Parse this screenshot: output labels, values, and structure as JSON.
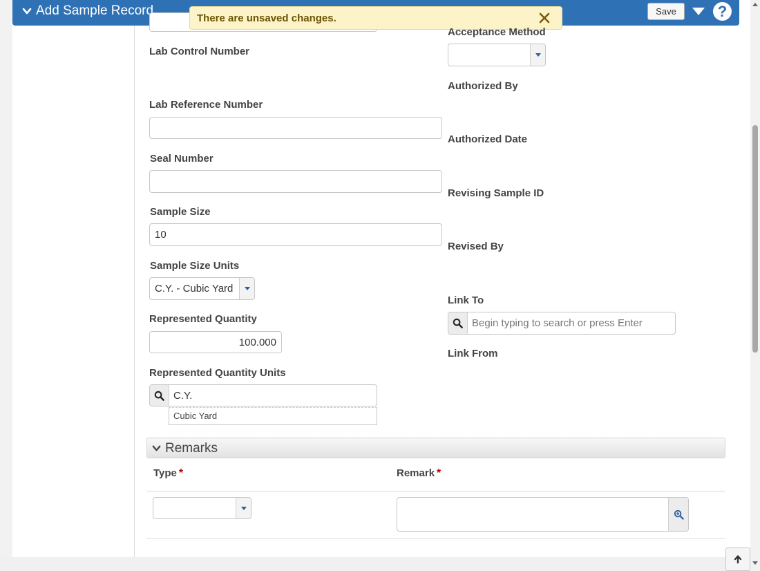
{
  "header": {
    "title": "Add Sample Record",
    "save_label": "Save",
    "help_label": "?"
  },
  "toast": {
    "message": "There are unsaved changes."
  },
  "left": {
    "lab_control_number": {
      "label": "Lab Control Number"
    },
    "lab_reference_number": {
      "label": "Lab Reference Number",
      "value": ""
    },
    "seal_number": {
      "label": "Seal Number",
      "value": ""
    },
    "sample_size": {
      "label": "Sample Size",
      "value": "10"
    },
    "sample_size_units": {
      "label": "Sample Size Units",
      "value": "C.Y. - Cubic Yard"
    },
    "represented_quantity": {
      "label": "Represented Quantity",
      "value": "100.000"
    },
    "represented_quantity_units": {
      "label": "Represented Quantity Units",
      "value": "C.Y.",
      "description": "Cubic Yard"
    }
  },
  "right": {
    "acceptance_method": {
      "label": "Acceptance Method",
      "value": ""
    },
    "authorized_by": {
      "label": "Authorized By"
    },
    "authorized_date": {
      "label": "Authorized Date"
    },
    "revising_sample_id": {
      "label": "Revising Sample ID"
    },
    "revised_by": {
      "label": "Revised By"
    },
    "link_to": {
      "label": "Link To",
      "placeholder": "Begin typing to search or press Enter"
    },
    "link_from": {
      "label": "Link From"
    }
  },
  "remarks": {
    "title": "Remarks",
    "col_type": "Type",
    "col_remark": "Remark",
    "required_mark": "*"
  },
  "colors": {
    "header_bg": "#2f71b5",
    "toast_bg": "#fcf3c8",
    "toast_text": "#6b5404",
    "required": "#bb0000"
  }
}
